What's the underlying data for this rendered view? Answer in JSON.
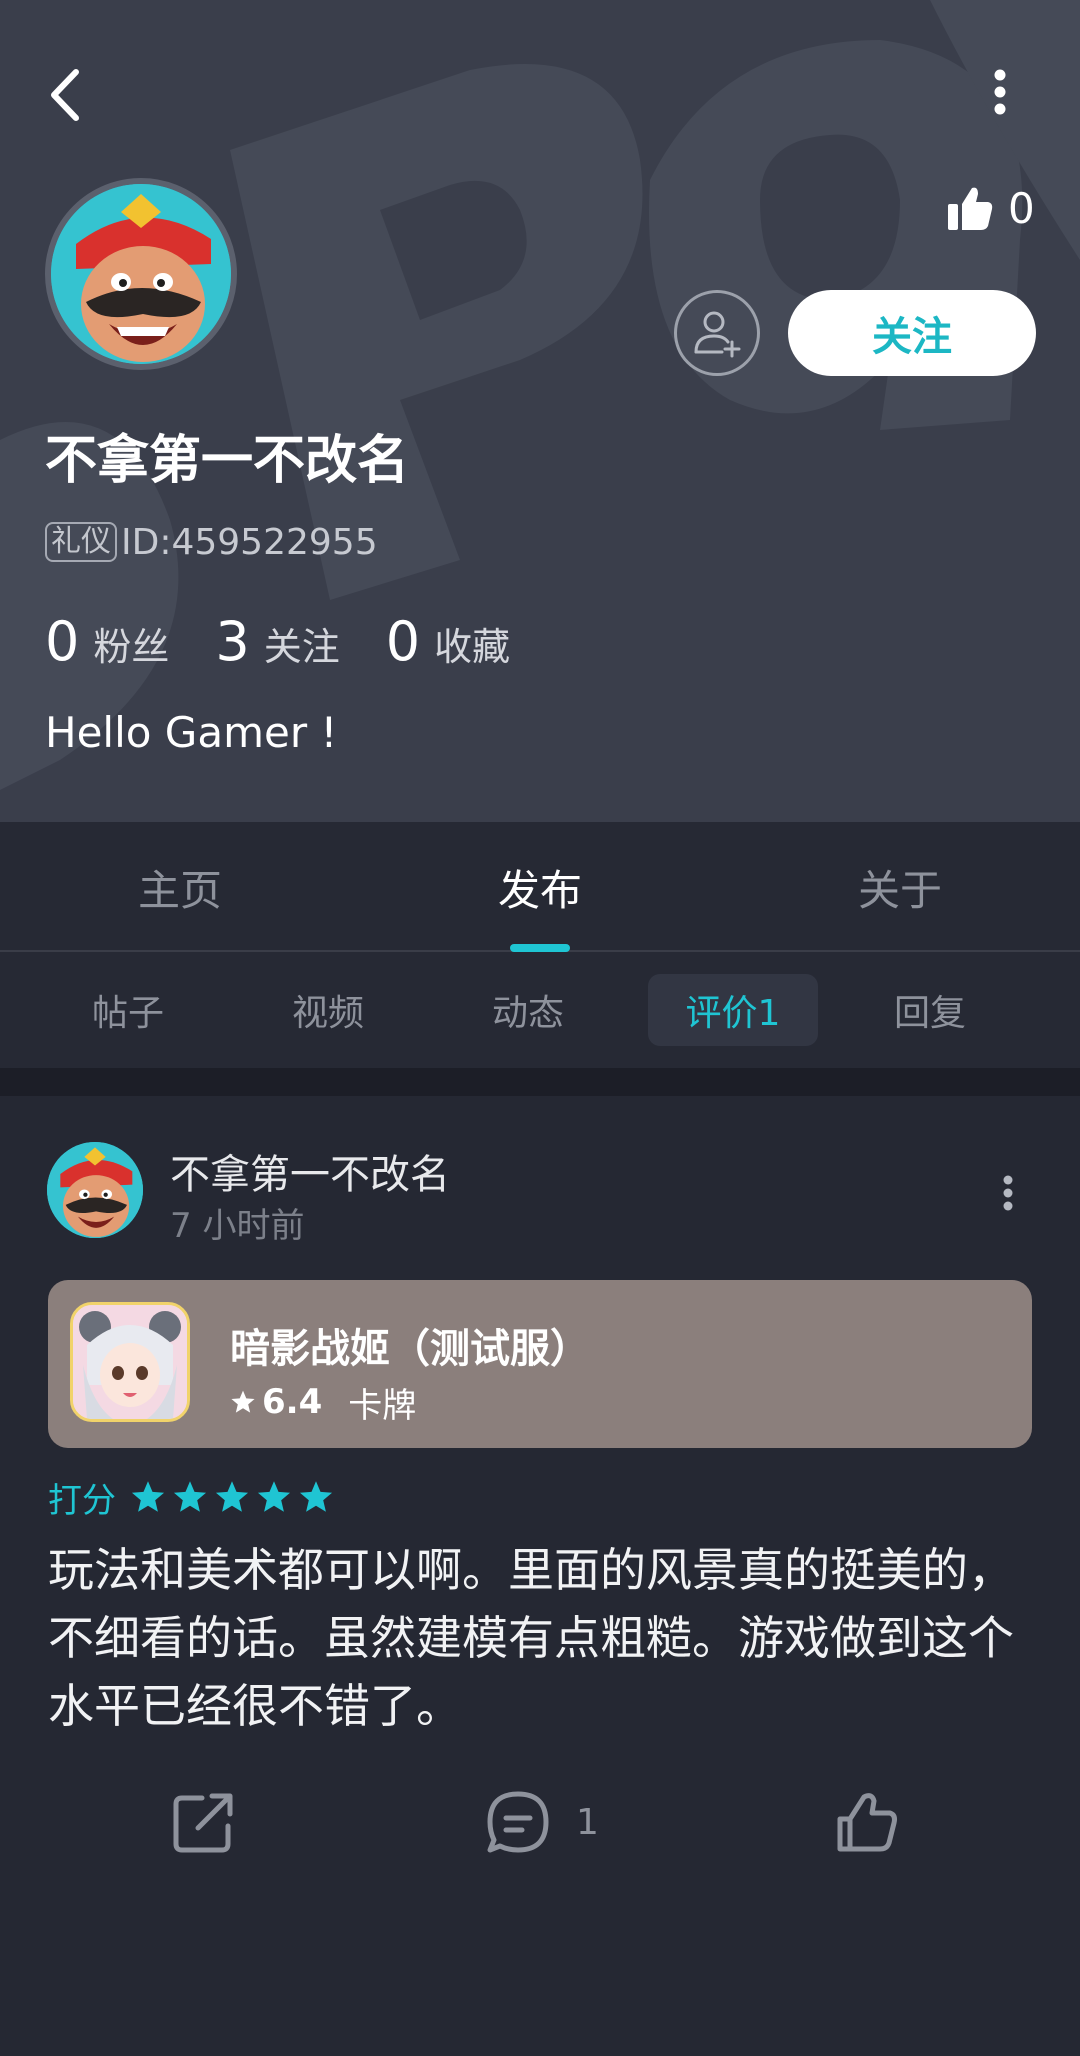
{
  "header": {
    "like_count": "0",
    "follow_label": "关注",
    "username": "不拿第一不改名",
    "badge": "礼仪",
    "user_id": "ID:459522955",
    "stats": [
      {
        "num": "0",
        "label": "粉丝"
      },
      {
        "num": "3",
        "label": "关注"
      },
      {
        "num": "0",
        "label": "收藏"
      }
    ],
    "bio": "Hello Gamer !"
  },
  "tabs": [
    {
      "label": "主页",
      "active": false
    },
    {
      "label": "发布",
      "active": true
    },
    {
      "label": "关于",
      "active": false
    }
  ],
  "subtabs": [
    {
      "label": "帖子",
      "active": false
    },
    {
      "label": "视频",
      "active": false
    },
    {
      "label": "动态",
      "active": false
    },
    {
      "label": "评价1",
      "active": true
    },
    {
      "label": "回复",
      "active": false
    }
  ],
  "post": {
    "author": "不拿第一不改名",
    "time": "7 小时前",
    "game": {
      "title": "暗影战姬（测试服）",
      "rating": "6.4",
      "genre": "卡牌"
    },
    "score_label": "打分",
    "stars": 5,
    "text": "玩法和美术都可以啊。里面的风景真的挺美的，不细看的话。虽然建模有点粗糙。游戏做到这个水平已经很不错了。",
    "comment_count": "1"
  },
  "colors": {
    "accent": "#1fc5d3",
    "header_bg": "#3a3e4b",
    "page_bg": "#232631",
    "game_card_bg": "#8b7f7c"
  },
  "icons": {
    "back": "chevron-left-icon",
    "more": "more-vertical-icon",
    "like": "thumbs-up-icon",
    "add_friend": "add-user-icon",
    "share": "share-icon",
    "comment": "comment-icon",
    "star": "star-icon"
  }
}
